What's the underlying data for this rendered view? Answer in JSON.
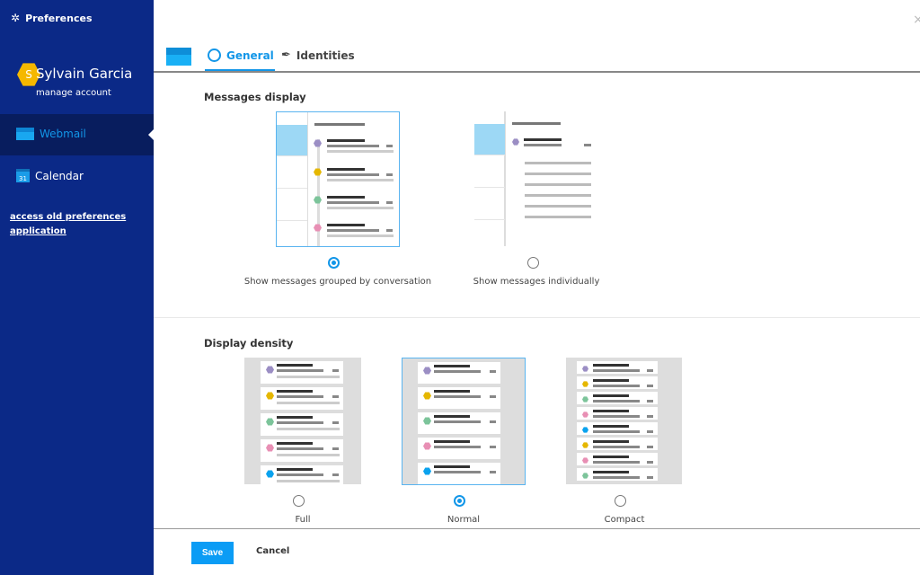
{
  "sidebar": {
    "title": "Preferences",
    "title_icon": "gear-icon",
    "user": {
      "initial": "S",
      "name": "Sylvain Garcia",
      "manage": "manage account",
      "avatar_color": "#f5b800"
    },
    "items": [
      {
        "label": "Webmail",
        "icon": "mail-icon",
        "selected": true,
        "color": "#1296e8"
      },
      {
        "label": "Calendar",
        "icon": "calendar-icon",
        "selected": false
      }
    ],
    "old_link": "access old preferences application",
    "bg": "#0b2987"
  },
  "tabs": [
    {
      "label": "General",
      "icon": "general-icon",
      "active": true
    },
    {
      "label": "Identities",
      "icon": "pen-icon",
      "active": false
    }
  ],
  "close": "×",
  "messages_display": {
    "heading": "Messages display",
    "options": [
      {
        "label": "Show messages grouped by conversation",
        "selected": true
      },
      {
        "label": "Show messages individually",
        "selected": false
      }
    ]
  },
  "display_density": {
    "heading": "Display density",
    "options": [
      {
        "label": "Full",
        "selected": false
      },
      {
        "label": "Normal",
        "selected": true
      },
      {
        "label": "Compact",
        "selected": false
      }
    ]
  },
  "dot_colors": [
    "#9b8ec4",
    "#e5b700",
    "#7cc49a",
    "#e88fb4",
    "#0aa2ee",
    "#e5b700",
    "#e88fb4",
    "#7cc49a"
  ],
  "accent": "#1296e8",
  "footer": {
    "save": "Save",
    "cancel": "Cancel"
  }
}
